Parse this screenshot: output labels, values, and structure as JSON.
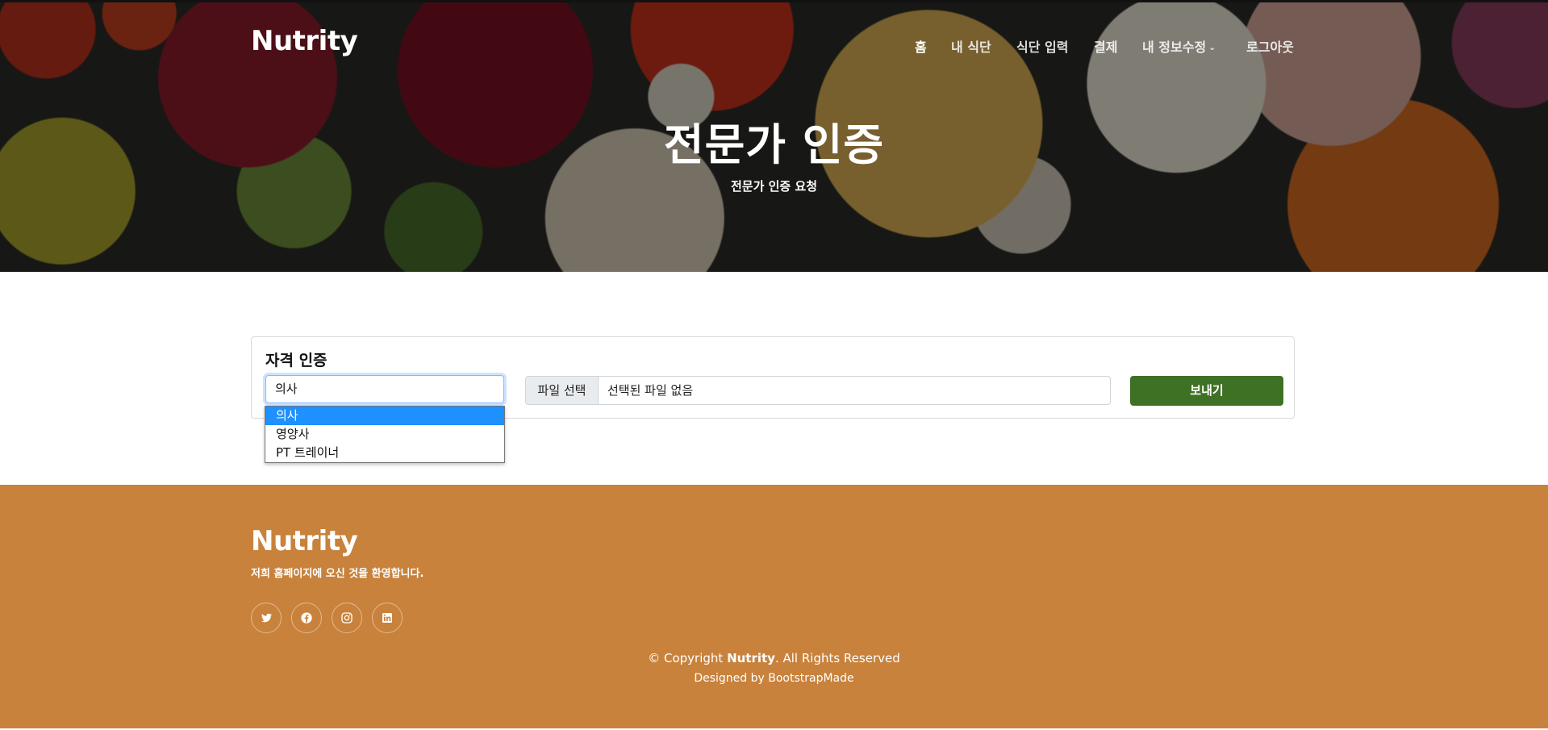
{
  "brand": "Nutrity",
  "nav": {
    "items": [
      {
        "label": "홈",
        "active": true
      },
      {
        "label": "내 식단"
      },
      {
        "label": "식단 입력"
      },
      {
        "label": "결제"
      },
      {
        "label": "내 정보수정",
        "has_dropdown": true,
        "icon": "chevron-down-icon"
      },
      {
        "label": "로그아웃"
      }
    ]
  },
  "hero": {
    "title": "전문가 인증",
    "subtitle": "전문가 인증 요청"
  },
  "form": {
    "title": "자격 인증",
    "select": {
      "value": "의사",
      "options": [
        "의사",
        "영양사",
        "PT 트레이너"
      ],
      "highlighted_index": 0
    },
    "file": {
      "button_label": "파일 선택",
      "status": "선택된 파일 없음"
    },
    "submit_label": "보내기",
    "accent_color": "#3f7125"
  },
  "footer": {
    "brand": "Nutrity",
    "welcome": "저희 홈페이지에 오신 것을 환영합니다.",
    "social": [
      {
        "icon": "twitter-icon"
      },
      {
        "icon": "facebook-icon"
      },
      {
        "icon": "instagram-icon"
      },
      {
        "icon": "linkedin-icon"
      }
    ],
    "copyright_prefix": "© Copyright",
    "copyright_brand": "Nutrity",
    "copyright_suffix": ". All Rights Reserved",
    "designed_by": "Designed by BootstrapMade",
    "background_color": "#c8823c"
  }
}
